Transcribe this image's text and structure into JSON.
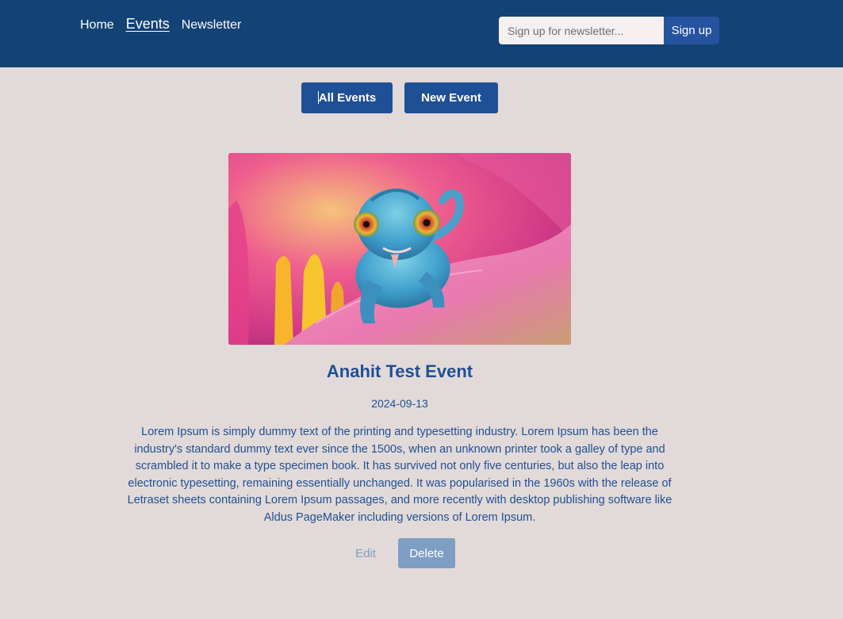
{
  "nav": {
    "items": [
      {
        "label": "Home",
        "active": false
      },
      {
        "label": "Events",
        "active": true
      },
      {
        "label": "Newsletter",
        "active": false
      }
    ]
  },
  "newsletter": {
    "placeholder": "Sign up for newsletter...",
    "value": "",
    "button_label": "Sign up"
  },
  "event_actions": {
    "all_events_label": "All Events",
    "new_event_label": "New Event"
  },
  "event": {
    "title": "Anahit Test Event",
    "date": "2024-09-13",
    "description": "Lorem Ipsum is simply dummy text of the printing and typesetting industry. Lorem Ipsum has been the industry's standard dummy text ever since the 1500s, when an unknown printer took a galley of type and scrambled it to make a type specimen book. It has survived not only five centuries, but also the leap into electronic typesetting, remaining essentially unchanged. It was popularised in the 1960s with the release of Letraset sheets containing Lorem Ipsum passages, and more recently with desktop publishing software like Aldus PageMaker including versions of Lorem Ipsum.",
    "edit_label": "Edit",
    "delete_label": "Delete"
  },
  "colors": {
    "header_bg": "#134275",
    "page_bg": "#e2dad8",
    "primary": "#1f4f95",
    "muted": "#7e9ec4"
  }
}
